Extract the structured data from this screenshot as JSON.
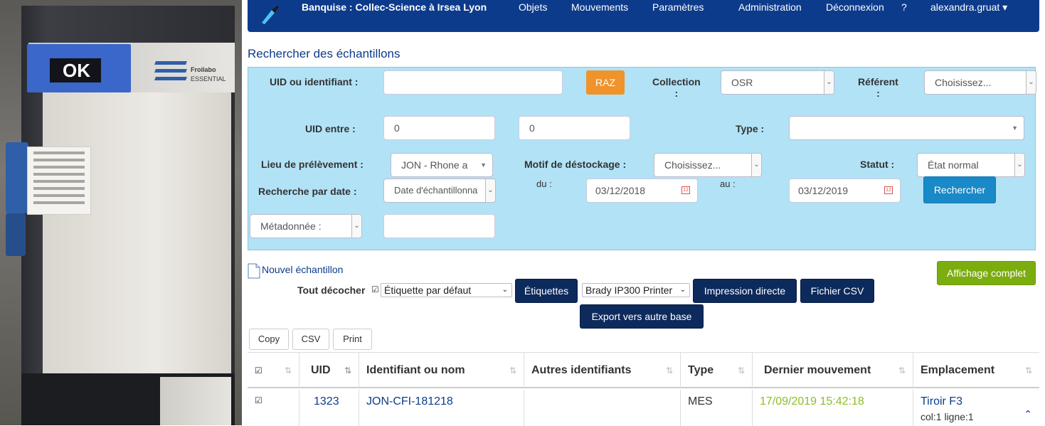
{
  "navbar": {
    "brand": "Banquise : Collec-Science à Irsea Lyon",
    "items": [
      "Objets",
      "Mouvements",
      "Paramètres",
      "Administration",
      "Déconnexion",
      "?",
      "alexandra.gruat ▾"
    ]
  },
  "photo": {
    "screen_text": "OK",
    "brand_line1": "Froilabo",
    "brand_line2": "ESSENTIAL"
  },
  "page_title": "Rechercher des échantillons",
  "search": {
    "uid_label": "UID ou identifiant :",
    "uid_value": "",
    "raz_label": "RAZ",
    "collection_label_1": "Collection",
    "collection_label_2": ":",
    "collection_value": "OSR",
    "referent_label_1": "Référent",
    "referent_label_2": ":",
    "referent_value": "Choisissez...",
    "uid_range_label": "UID entre :",
    "uid_from": "0",
    "uid_to": "0",
    "type_label": "Type :",
    "type_value": "",
    "lieu_label": "Lieu de prélèvement :",
    "lieu_value": "JON - Rhone a",
    "motif_label": "Motif de déstockage :",
    "motif_value": "Choisissez...",
    "statut_label": "Statut :",
    "statut_value": "État normal",
    "date_label": "Recherche par date :",
    "date_type_value": "Date d'échantillonna",
    "du_label": "du :",
    "date_from": "03/12/2018",
    "au_label": "au :",
    "date_to": "03/12/2019",
    "search_button": "Rechercher",
    "meta_label": "Métadonnée :",
    "meta_value": ""
  },
  "actions": {
    "new_sample": "Nouvel échantillon",
    "full_display": "Affichage complet",
    "uncheck_all": "Tout décocher",
    "label_select": "Étiquette par défaut",
    "labels_button": "Étiquettes",
    "printer_select": "Brady IP300 Printer",
    "direct_print_button": "Impression directe",
    "csv_button": "Fichier CSV",
    "export_button": "Export vers autre base",
    "copy": "Copy",
    "csv": "CSV",
    "print": "Print"
  },
  "table": {
    "headers": [
      "☑",
      "UID",
      "Identifiant ou nom",
      "Autres identifiants",
      "Type",
      "Dernier mouvement",
      "Emplacement"
    ],
    "rows": [
      {
        "check": "☑",
        "uid": "1323",
        "name": "JON-CFI-181218",
        "others": "",
        "type": "MES",
        "last_move": "17/09/2019 15:42:18",
        "location": "Tiroir F3",
        "location_detail": "col:1 ligne:1"
      }
    ]
  },
  "colors": {
    "navbar": "#0d3b8c",
    "search_bg": "#b2e2f6",
    "raz": "#f0932b",
    "search_btn": "#1a89c7",
    "dark_btn": "#0d2a5c",
    "green_btn": "#7cad0f",
    "date_green": "#8cbf26"
  }
}
